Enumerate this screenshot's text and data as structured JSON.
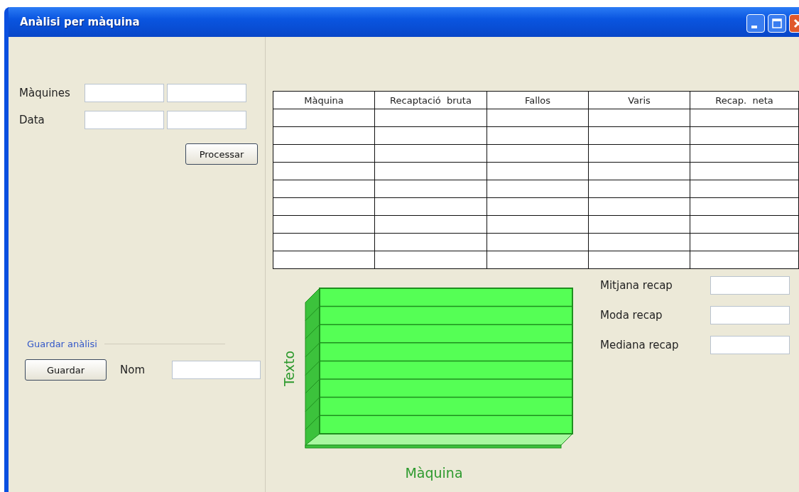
{
  "window": {
    "title": "Anàlisi per màquina"
  },
  "filters": [
    {
      "label": "Màquines"
    },
    {
      "label": "Data"
    }
  ],
  "process_button": "Processar",
  "save_group": {
    "title": "Guardar anàlisi",
    "button": "Guardar",
    "name_label": "Nom"
  },
  "table": {
    "columns": [
      "Màquina",
      "Recaptació  bruta",
      "Fallos",
      "Varis",
      "Recap.  neta"
    ]
  },
  "chart": {
    "ylabel": "Texto",
    "xlabel": "Màquina"
  },
  "stats": [
    {
      "label": "Mitjana recap"
    },
    {
      "label": "Moda recap"
    },
    {
      "label": "Mediana recap"
    }
  ]
}
